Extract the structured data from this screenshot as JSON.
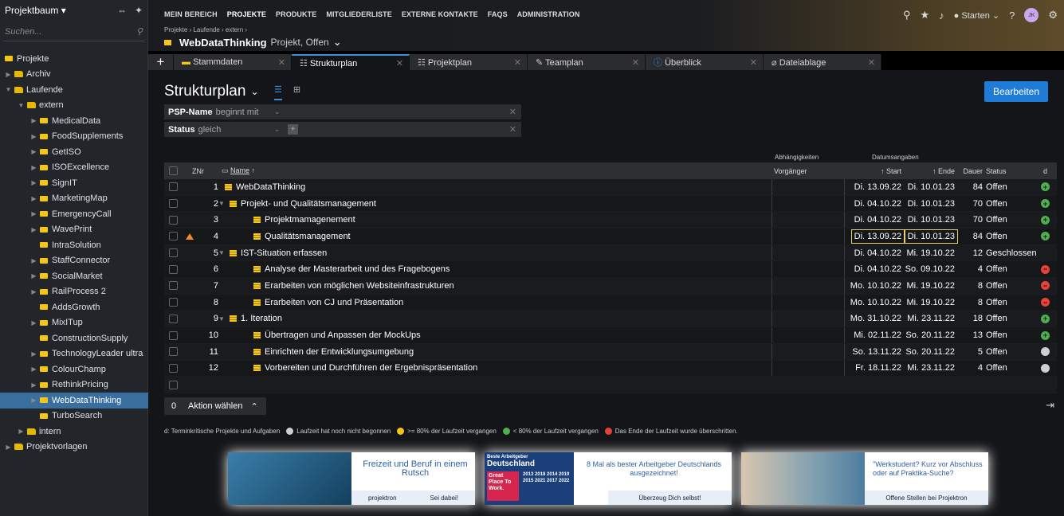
{
  "sidebar": {
    "title": "Projektbaum ▾",
    "search_placeholder": "Suchen...",
    "items": [
      {
        "label": "Projekte",
        "indent": 0,
        "kind": "root",
        "arrow": ""
      },
      {
        "label": "Archiv",
        "indent": 0,
        "kind": "fo",
        "arrow": "▶"
      },
      {
        "label": "Laufende",
        "indent": 0,
        "kind": "fo",
        "arrow": "▼"
      },
      {
        "label": "extern",
        "indent": 1,
        "kind": "fo",
        "arrow": "▼"
      },
      {
        "label": "MedicalData",
        "indent": 2,
        "kind": "fi",
        "arrow": "▶"
      },
      {
        "label": "FoodSupplements",
        "indent": 2,
        "kind": "fi",
        "arrow": "▶"
      },
      {
        "label": "GetISO",
        "indent": 2,
        "kind": "fi",
        "arrow": "▶"
      },
      {
        "label": "ISOExcellence",
        "indent": 2,
        "kind": "fi",
        "arrow": "▶"
      },
      {
        "label": "SignIT",
        "indent": 2,
        "kind": "fi",
        "arrow": "▶"
      },
      {
        "label": "MarketingMap",
        "indent": 2,
        "kind": "fi",
        "arrow": "▶"
      },
      {
        "label": "EmergencyCall",
        "indent": 2,
        "kind": "fi",
        "arrow": "▶"
      },
      {
        "label": "WavePrint",
        "indent": 2,
        "kind": "fi",
        "arrow": "▶"
      },
      {
        "label": "IntraSolution",
        "indent": 2,
        "kind": "fi",
        "arrow": ""
      },
      {
        "label": "StaffConnector",
        "indent": 2,
        "kind": "fi",
        "arrow": "▶"
      },
      {
        "label": "SocialMarket",
        "indent": 2,
        "kind": "fi",
        "arrow": "▶"
      },
      {
        "label": "RailProcess 2",
        "indent": 2,
        "kind": "fi",
        "arrow": "▶"
      },
      {
        "label": "AddsGrowth",
        "indent": 2,
        "kind": "fi",
        "arrow": ""
      },
      {
        "label": "MixITup",
        "indent": 2,
        "kind": "fi",
        "arrow": "▶"
      },
      {
        "label": "ConstructionSupply",
        "indent": 2,
        "kind": "fi",
        "arrow": ""
      },
      {
        "label": "TechnologyLeader ultra",
        "indent": 2,
        "kind": "fi",
        "arrow": "▶"
      },
      {
        "label": "ColourChamp",
        "indent": 2,
        "kind": "fi",
        "arrow": "▶"
      },
      {
        "label": "RethinkPricing",
        "indent": 2,
        "kind": "fi",
        "arrow": "▶"
      },
      {
        "label": "WebDataThinking",
        "indent": 2,
        "kind": "fi",
        "arrow": "▶",
        "selected": true
      },
      {
        "label": "TurboSearch",
        "indent": 2,
        "kind": "fi",
        "arrow": ""
      },
      {
        "label": "intern",
        "indent": 1,
        "kind": "fo",
        "arrow": "▶"
      },
      {
        "label": "Projektvorlagen",
        "indent": 0,
        "kind": "fo",
        "arrow": "▶"
      }
    ]
  },
  "nav": {
    "items": [
      "MEIN BEREICH",
      "PROJEKTE",
      "PRODUKTE",
      "MITGLIEDERLISTE",
      "EXTERNE KONTAKTE",
      "FAQS",
      "ADMINISTRATION"
    ],
    "active": 1
  },
  "breadcrumb": "Projekte › Laufende › extern ›",
  "project": {
    "name": "WebDataThinking",
    "meta": "Projekt, Offen"
  },
  "topright": {
    "start_label": "Starten",
    "avatar": "JK"
  },
  "tabs": [
    {
      "label": "Stammdaten",
      "active": false
    },
    {
      "label": "Strukturplan",
      "active": true
    },
    {
      "label": "Projektplan",
      "active": false
    },
    {
      "label": "Teamplan",
      "active": false
    },
    {
      "label": "Überblick",
      "active": false
    },
    {
      "label": "Dateiablage",
      "active": false
    }
  ],
  "page": {
    "title": "Strukturplan",
    "edit_button": "Bearbeiten"
  },
  "filters": [
    {
      "label": "PSP-Name",
      "op": "beginnt mit"
    },
    {
      "label": "Status",
      "op": "gleich"
    }
  ],
  "grid": {
    "group_dep": "Abhängigkeiten",
    "group_date": "Datumsangaben",
    "headers": {
      "nr": "ZNr",
      "name": "Name",
      "pred": "Vorgänger",
      "start": "Start",
      "end": "Ende",
      "dur": "Dauer",
      "status": "Status",
      "d": "d"
    },
    "rows": [
      {
        "nr": "1",
        "name": "WebDataThinking",
        "lvl": 0,
        "tog": "",
        "ico": "l",
        "start": "Di. 13.09.22",
        "end": "Di. 10.01.23",
        "dur": "84",
        "status": "Offen",
        "d": "green"
      },
      {
        "nr": "2",
        "name": "Projekt- und Qualitätsmanagement",
        "lvl": 0,
        "tog": "▼",
        "ico": "l",
        "start": "Di. 04.10.22",
        "end": "Di. 10.01.23",
        "dur": "70",
        "status": "Offen",
        "d": "green"
      },
      {
        "nr": "3",
        "name": "Projektmamagenement",
        "lvl": 1,
        "tog": "",
        "ico": "l",
        "start": "Di. 04.10.22",
        "end": "Di. 10.01.23",
        "dur": "70",
        "status": "Offen",
        "d": "green"
      },
      {
        "nr": "4",
        "name": "Qualitätsmanagement",
        "lvl": 1,
        "tog": "",
        "ico": "l",
        "start": "Di. 13.09.22",
        "end": "Di. 10.01.23",
        "dur": "84",
        "status": "Offen",
        "d": "green",
        "warn": true,
        "hl": true
      },
      {
        "nr": "5",
        "name": "IST-Situation erfassen",
        "lvl": 0,
        "tog": "▼",
        "ico": "l",
        "start": "Di. 04.10.22",
        "end": "Mi. 19.10.22",
        "dur": "12",
        "status": "Geschlossen",
        "d": ""
      },
      {
        "nr": "6",
        "name": "Analyse der Masterarbeit und des Fragebogens",
        "lvl": 1,
        "tog": "",
        "ico": "l",
        "start": "Di. 04.10.22",
        "end": "So. 09.10.22",
        "dur": "4",
        "status": "Offen",
        "d": "red"
      },
      {
        "nr": "7",
        "name": "Erarbeiten von möglichen Websiteinfrastrukturen",
        "lvl": 1,
        "tog": "",
        "ico": "l",
        "start": "Mo. 10.10.22",
        "end": "Mi. 19.10.22",
        "dur": "8",
        "status": "Offen",
        "d": "red"
      },
      {
        "nr": "8",
        "name": "Erarbeiten von CJ und Präsentation",
        "lvl": 1,
        "tog": "",
        "ico": "l",
        "start": "Mo. 10.10.22",
        "end": "Mi. 19.10.22",
        "dur": "8",
        "status": "Offen",
        "d": "red"
      },
      {
        "nr": "9",
        "name": "1. Iteration",
        "lvl": 0,
        "tog": "▼",
        "ico": "l",
        "start": "Mo. 31.10.22",
        "end": "Mi. 23.11.22",
        "dur": "18",
        "status": "Offen",
        "d": "green"
      },
      {
        "nr": "10",
        "name": "Übertragen und Anpassen der MockUps",
        "lvl": 1,
        "tog": "",
        "ico": "l",
        "start": "Mi. 02.11.22",
        "end": "So. 20.11.22",
        "dur": "13",
        "status": "Offen",
        "d": "green"
      },
      {
        "nr": "11",
        "name": "Einrichten der Entwicklungsumgebung",
        "lvl": 1,
        "tog": "",
        "ico": "l",
        "start": "So. 13.11.22",
        "end": "So. 20.11.22",
        "dur": "5",
        "status": "Offen",
        "d": "gray"
      },
      {
        "nr": "12",
        "name": "Vorbereiten und Durchführen der Ergebnispräsentation",
        "lvl": 1,
        "tog": "",
        "ico": "l",
        "start": "Fr. 18.11.22",
        "end": "Mi. 23.11.22",
        "dur": "4",
        "status": "Offen",
        "d": "gray"
      }
    ]
  },
  "actionbar": {
    "count": "0",
    "label": "Aktion wählen"
  },
  "legend": {
    "prefix": "d: Terminkritische Projekte und Aufgaben",
    "gray": "Laufzeit hat noch nicht begonnen",
    "yellow": ">= 80% der Laufzeit vergangen",
    "green": "< 80% der Laufzeit vergangen",
    "red": "Das Ende der Laufzeit wurde überschritten."
  },
  "colors": {
    "green": "#4caf50",
    "red": "#e8413a",
    "gray": "#cfcfcf",
    "yellow": "#f5c518",
    "accent": "#1e7bd8"
  },
  "ads": [
    {
      "title": "Freizeit und Beruf in einem Rutsch",
      "logo": "projektron",
      "cta": "Sei dabei!"
    },
    {
      "badge_small": "Beste Arbeitgeber",
      "badge_title": "Deutschland",
      "badge_red": "Great Place To Work.",
      "badge_years": "2013 2018 2014 2019 2015 2021 2017 2022",
      "title": "8 Mal als bester Arbeitgeber Deutschlands ausgezeichnet!",
      "cta": "Überzeug Dich selbst!"
    },
    {
      "title": "\"Werkstudent? Kurz vor Abschluss oder auf Praktika-Suche?",
      "cta": "Offene Stellen bei Projektron"
    }
  ]
}
